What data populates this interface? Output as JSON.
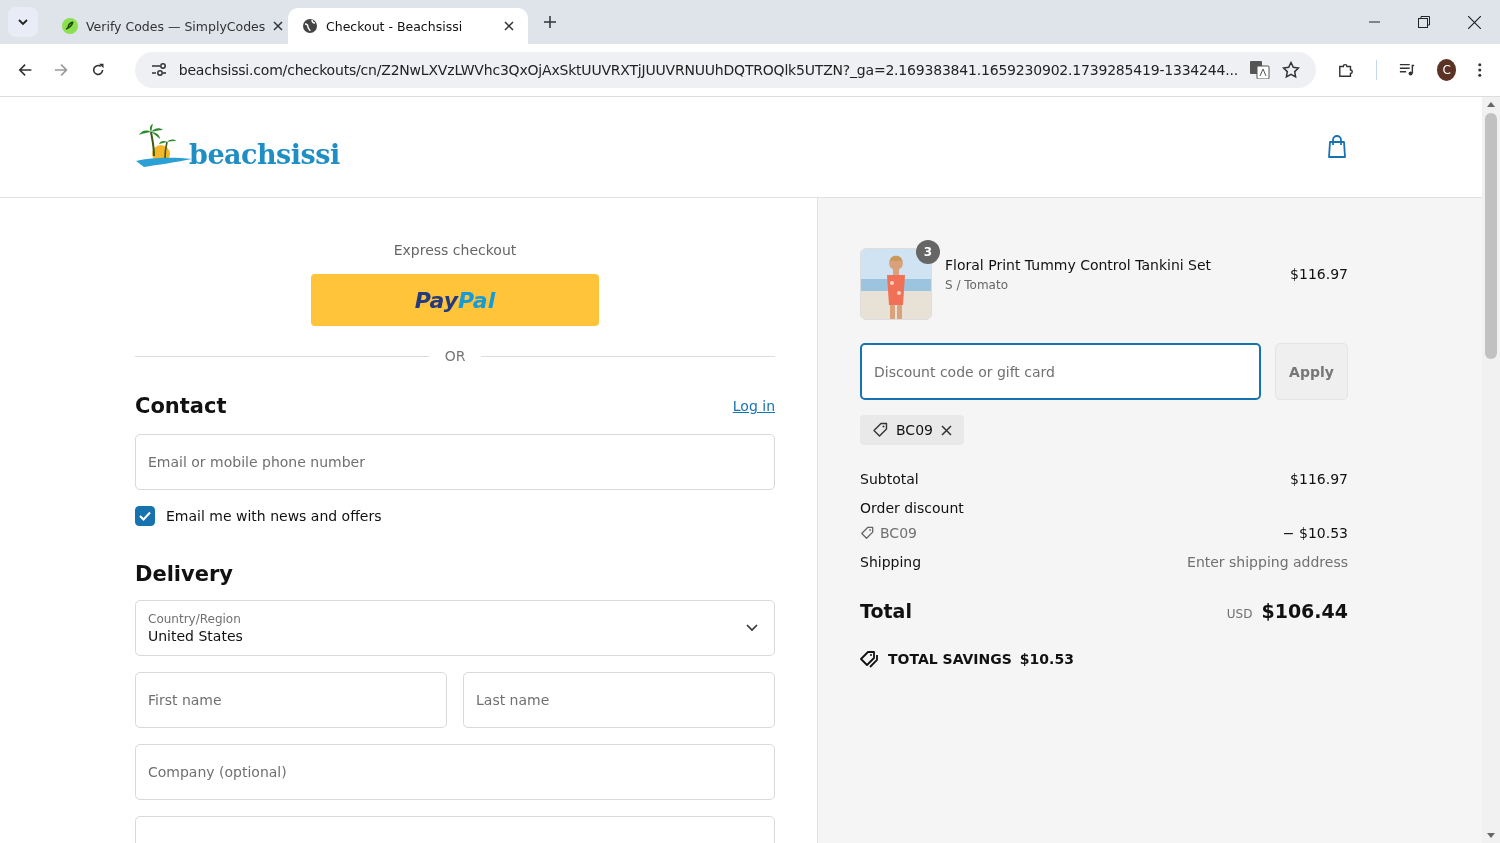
{
  "browser": {
    "tabs": [
      {
        "title": "Verify Codes — SimplyCodes",
        "selected": false
      },
      {
        "title": "Checkout - Beachsissi",
        "selected": true
      }
    ],
    "url": "beachsissi.com/checkouts/cn/Z2NwLXVzLWVhc3QxOjAxSktUUVRXTjJUUVRNUUhDQTROQlk5UTZN?_ga=2.169383841.1659230902.1739285419-1334244...",
    "profile_initial": "C"
  },
  "header": {
    "logo_text": "beachsissi"
  },
  "checkout": {
    "express_label": "Express checkout",
    "paypal": [
      "Pay",
      "Pal"
    ],
    "divider": "OR",
    "contact": {
      "heading": "Contact",
      "login": "Log in",
      "email_placeholder": "Email or mobile phone number",
      "newsletter": {
        "label": "Email me with news and offers",
        "checked": true
      }
    },
    "delivery": {
      "heading": "Delivery",
      "country_label": "Country/Region",
      "country": "United States",
      "first_name_placeholder": "First name",
      "last_name_placeholder": "Last name",
      "company_placeholder": "Company (optional)"
    }
  },
  "summary": {
    "item": {
      "quantity": "3",
      "name": "Floral Print Tummy Control Tankini Set",
      "variant": "S / Tomato",
      "price": "$116.97"
    },
    "discount_placeholder": "Discount code or gift card",
    "apply": "Apply",
    "applied_code": "BC09",
    "lines": [
      {
        "kind": "plain",
        "label": "Subtotal",
        "value": "$116.97"
      },
      {
        "kind": "discount",
        "label": "Order discount",
        "code": "BC09",
        "value": "− $10.53"
      },
      {
        "kind": "muted",
        "label": "Shipping",
        "value": "Enter shipping address"
      }
    ],
    "total": {
      "label": "Total",
      "currency": "USD",
      "value": "$106.44"
    },
    "savings": {
      "label": "TOTAL SAVINGS",
      "value": "$10.53"
    }
  }
}
